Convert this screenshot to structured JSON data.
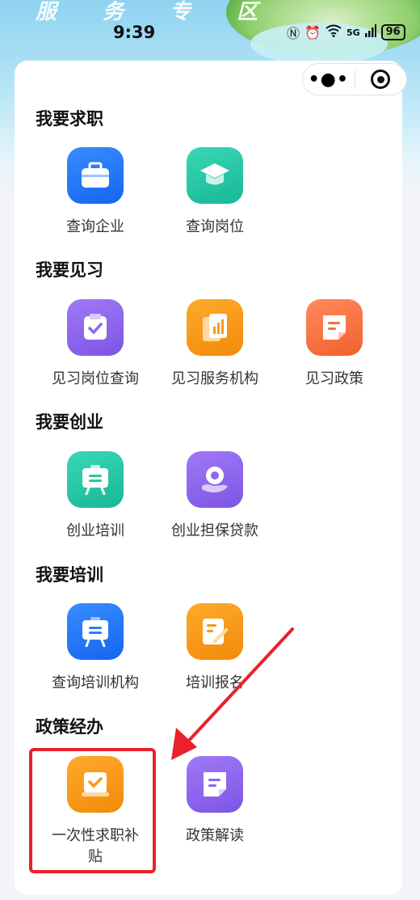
{
  "status_bar": {
    "time": "9:39",
    "battery": "96",
    "signal": "5G",
    "banner_text": "服 务 专 区"
  },
  "capsule": {
    "more_label": "•●•"
  },
  "sections": [
    {
      "title": "我要求职",
      "items": [
        {
          "label": "查询企业",
          "icon": "briefcase-icon",
          "color": "#2f7cf6"
        },
        {
          "label": "查询岗位",
          "icon": "graduation-cap-icon",
          "color": "#25c9a6"
        }
      ]
    },
    {
      "title": "我要见习",
      "items": [
        {
          "label": "见习岗位查询",
          "icon": "clipboard-check-icon",
          "color": "#8d66ee"
        },
        {
          "label": "见习服务机构",
          "icon": "bar-chart-doc-icon",
          "color": "#f59a17"
        },
        {
          "label": "见习政策",
          "icon": "note-icon",
          "color": "#f5713f"
        }
      ]
    },
    {
      "title": "我要创业",
      "items": [
        {
          "label": "创业培训",
          "icon": "easel-icon",
          "color": "#25c9a6"
        },
        {
          "label": "创业担保贷款",
          "icon": "hand-coin-icon",
          "color": "#8d66ee"
        }
      ]
    },
    {
      "title": "我要培训",
      "items": [
        {
          "label": "查询培训机构",
          "icon": "easel-icon",
          "color": "#2f7cf6"
        },
        {
          "label": "培训报名",
          "icon": "edit-doc-icon",
          "color": "#f59a17"
        }
      ]
    },
    {
      "title": "政策经办",
      "items": [
        {
          "label": "一次性求职补贴",
          "icon": "check-doc-icon",
          "color": "#f59a17"
        },
        {
          "label": "政策解读",
          "icon": "doc-lines-icon",
          "color": "#8d66ee"
        }
      ]
    }
  ],
  "annotation": {
    "highlight_color": "#e8212b"
  }
}
